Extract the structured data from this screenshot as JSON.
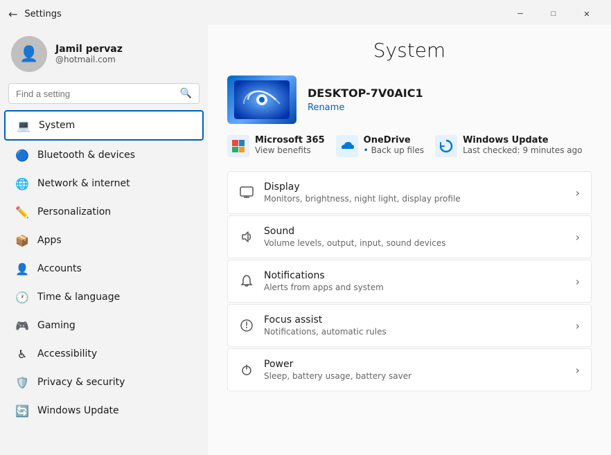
{
  "titleBar": {
    "title": "Settings",
    "backArrow": "←",
    "controls": {
      "minimize": "─",
      "maximize": "□",
      "close": "✕"
    }
  },
  "sidebar": {
    "user": {
      "name": "Jamil pervaz",
      "email": "@hotmail.com"
    },
    "search": {
      "placeholder": "Find a setting"
    },
    "navItems": [
      {
        "id": "system",
        "label": "System",
        "icon": "💻",
        "active": true
      },
      {
        "id": "bluetooth",
        "label": "Bluetooth & devices",
        "icon": "🔵",
        "active": false
      },
      {
        "id": "network",
        "label": "Network & internet",
        "icon": "🌐",
        "active": false
      },
      {
        "id": "personalization",
        "label": "Personalization",
        "icon": "✏️",
        "active": false
      },
      {
        "id": "apps",
        "label": "Apps",
        "icon": "📦",
        "active": false
      },
      {
        "id": "accounts",
        "label": "Accounts",
        "icon": "👤",
        "active": false
      },
      {
        "id": "timelang",
        "label": "Time & language",
        "icon": "🕐",
        "active": false
      },
      {
        "id": "gaming",
        "label": "Gaming",
        "icon": "🎮",
        "active": false
      },
      {
        "id": "accessibility",
        "label": "Accessibility",
        "icon": "♿",
        "active": false
      },
      {
        "id": "privacy",
        "label": "Privacy & security",
        "icon": "🛡️",
        "active": false
      },
      {
        "id": "update",
        "label": "Windows Update",
        "icon": "🔄",
        "active": false
      }
    ]
  },
  "main": {
    "title": "System",
    "device": {
      "name": "DESKTOP-7V0AIC1",
      "renameLabel": "Rename"
    },
    "services": [
      {
        "id": "ms365",
        "name": "Microsoft 365",
        "desc": "View benefits",
        "iconType": "ms365"
      },
      {
        "id": "onedrive",
        "name": "OneDrive",
        "desc": "Back up files",
        "iconType": "onedrive"
      },
      {
        "id": "winupdate",
        "name": "Windows Update",
        "desc": "Last checked: 9 minutes ago",
        "iconType": "winupdate"
      }
    ],
    "settingsItems": [
      {
        "id": "display",
        "title": "Display",
        "desc": "Monitors, brightness, night light, display profile"
      },
      {
        "id": "sound",
        "title": "Sound",
        "desc": "Volume levels, output, input, sound devices"
      },
      {
        "id": "notifications",
        "title": "Notifications",
        "desc": "Alerts from apps and system"
      },
      {
        "id": "focusassist",
        "title": "Focus assist",
        "desc": "Notifications, automatic rules"
      },
      {
        "id": "power",
        "title": "Power",
        "desc": "Sleep, battery usage, battery saver"
      }
    ]
  }
}
